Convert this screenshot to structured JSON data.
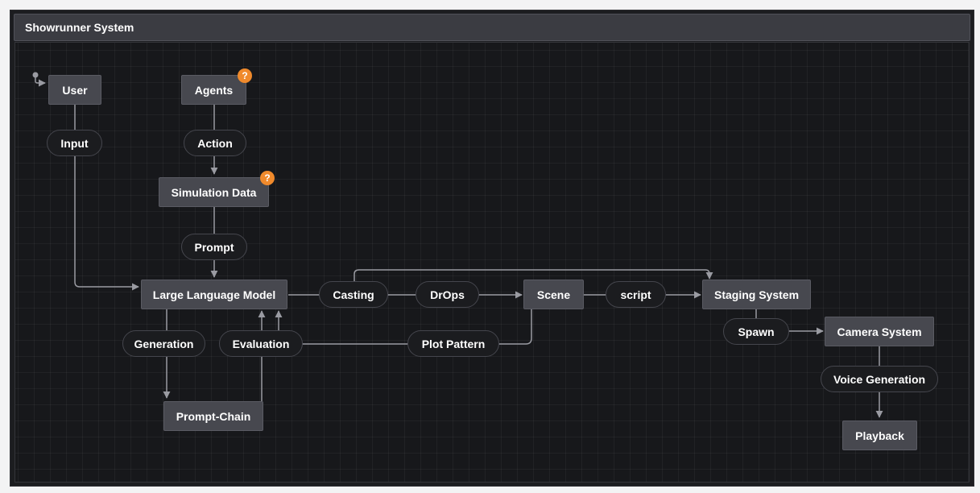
{
  "title": "Showrunner System",
  "colors": {
    "state_fill": "#47484f",
    "event_fill": "#1b1c1f",
    "edge": "#9a9ba2",
    "badge": "#f08a2c",
    "background": "#17181b"
  },
  "initial_icon": "initial-state-icon",
  "badge_icon": "question-mark-icon",
  "badge_label": "?",
  "states": {
    "user": "User",
    "agents": "Agents",
    "simulation_data": "Simulation Data",
    "llm": "Large Language Model",
    "prompt_chain": "Prompt-Chain",
    "scene": "Scene",
    "staging_system": "Staging System",
    "camera_system": "Camera System",
    "playback": "Playback"
  },
  "events": {
    "input": "Input",
    "action": "Action",
    "prompt": "Prompt",
    "casting": "Casting",
    "drops": "DrOps",
    "script": "script",
    "generation": "Generation",
    "evaluation": "Evaluation",
    "plot_pattern": "Plot Pattern",
    "spawn": "Spawn",
    "voice_generation": "Voice Generation"
  }
}
